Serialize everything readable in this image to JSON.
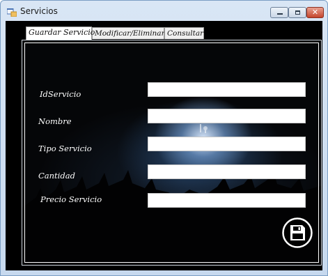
{
  "window": {
    "title": "Servicios",
    "close_glyph": "✕"
  },
  "tabs": [
    {
      "label": "Guardar Servicio",
      "selected": true
    },
    {
      "label": "Modificar/Eliminar",
      "selected": false
    },
    {
      "label": "Consultar",
      "selected": false
    }
  ],
  "form": {
    "fields": [
      {
        "label": "IdServicio",
        "value": ""
      },
      {
        "label": "Nombre",
        "value": ""
      },
      {
        "label": "Tipo Servicio",
        "value": ""
      },
      {
        "label": "Cantidad",
        "value": ""
      },
      {
        "label": "Precio Servicio",
        "value": ""
      }
    ],
    "save_icon": "floppy-disk-save-icon"
  },
  "colors": {
    "client_bg": "#000000",
    "label_text": "#ffffff",
    "field_bg": "#ffffff",
    "close_button": "#c4452c"
  }
}
